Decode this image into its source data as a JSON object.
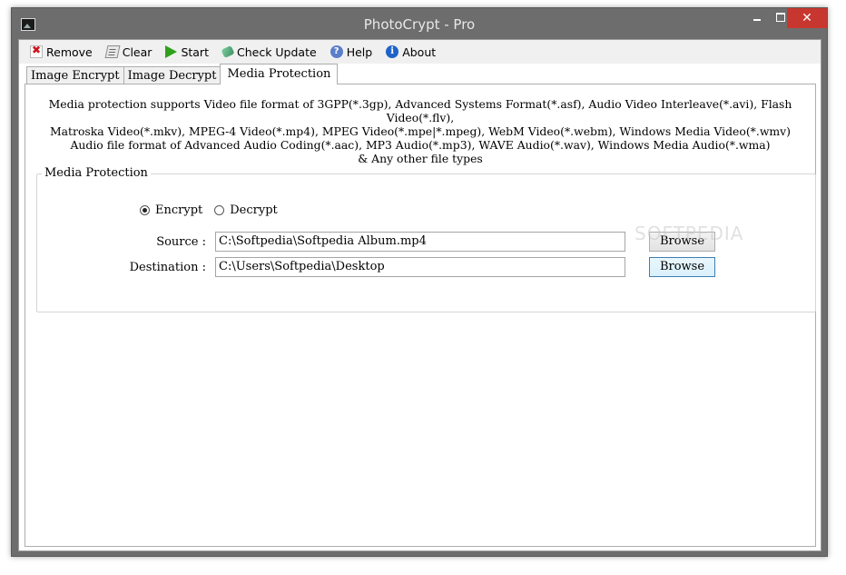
{
  "window": {
    "title": "PhotoCrypt - Pro",
    "close_symbol": "✕"
  },
  "toolbar": [
    {
      "id": "remove",
      "label": "Remove",
      "icon": "remove-icon"
    },
    {
      "id": "clear",
      "label": "Clear",
      "icon": "clear-icon"
    },
    {
      "id": "start",
      "label": "Start",
      "icon": "start-icon"
    },
    {
      "id": "check-update",
      "label": "Check Update",
      "icon": "check-update-icon"
    },
    {
      "id": "help",
      "label": "Help",
      "icon": "help-icon",
      "glyph": "?"
    },
    {
      "id": "about",
      "label": "About",
      "icon": "about-icon",
      "glyph": "i"
    }
  ],
  "tabs": [
    {
      "label": "Image Encrypt",
      "active": false
    },
    {
      "label": "Image Decrypt",
      "active": false
    },
    {
      "label": "Media Protection",
      "active": true
    }
  ],
  "media_protection": {
    "info_lines": [
      "Media protection supports Video file format of 3GPP(*.3gp), Advanced Systems Format(*.asf), Audio Video Interleave(*.avi), Flash Video(*.flv),",
      "Matroska Video(*.mkv), MPEG-4 Video(*.mp4), MPEG Video(*.mpe|*.mpeg), WebM Video(*.webm), Windows Media Video(*.wmv)",
      "Audio file format of Advanced Audio Coding(*.aac), MP3 Audio(*.mp3), WAVE Audio(*.wav), Windows Media Audio(*.wma)",
      "& Any other file types"
    ],
    "group_title": "Media Protection",
    "mode": {
      "encrypt_label": "Encrypt",
      "decrypt_label": "Decrypt",
      "selected": "Encrypt"
    },
    "source": {
      "label": "Source :",
      "value": "C:\\Softpedia\\Softpedia Album.mp4",
      "button": "Browse"
    },
    "destination": {
      "label": "Destination :",
      "value": "C:\\Users\\Softpedia\\Desktop",
      "button": "Browse"
    },
    "watermark": "SOFTPEDIA"
  },
  "colors": {
    "close_button": "#c7372f",
    "frame": "#6d6d6d",
    "focus_border": "#3c7fb1"
  }
}
